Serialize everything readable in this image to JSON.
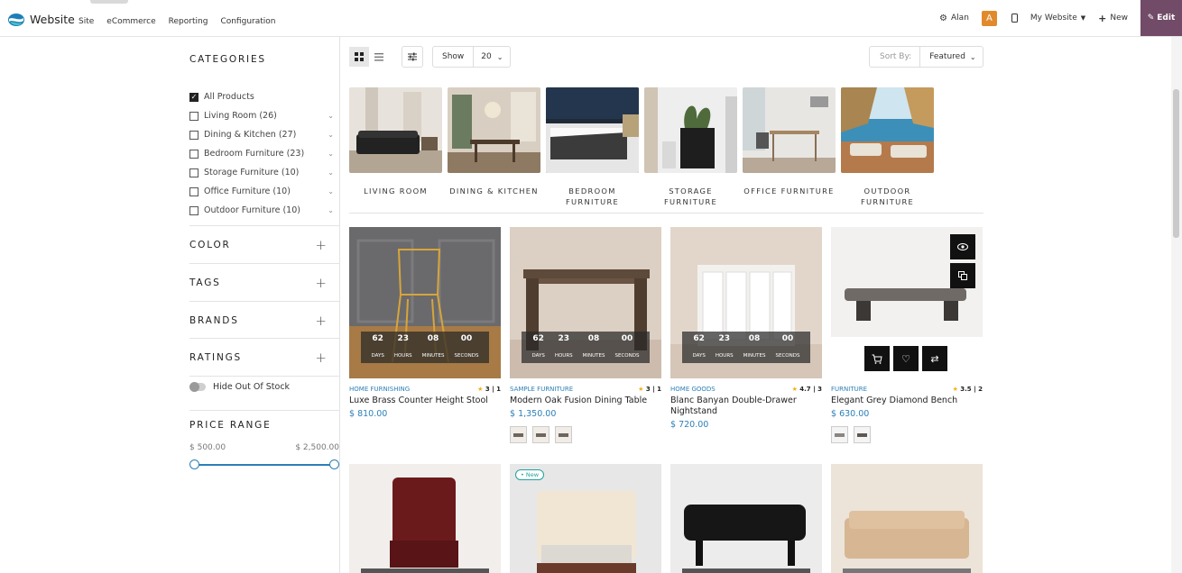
{
  "topbar": {
    "brand": "Website",
    "menu": [
      "Site",
      "eCommerce",
      "Reporting",
      "Configuration"
    ],
    "user": "Alan",
    "avatar_letter": "A",
    "website_select": "My Website",
    "new_label": "New",
    "edit_label": "Edit",
    "edit_color": "#714b67"
  },
  "sidebar": {
    "categories_title": "CATEGORIES",
    "categories": [
      {
        "label": "All Products",
        "checked": true
      },
      {
        "label": "Living Room (26)",
        "checked": false
      },
      {
        "label": "Dining & Kitchen (27)",
        "checked": false
      },
      {
        "label": "Bedroom Furniture (23)",
        "checked": false
      },
      {
        "label": "Storage Furniture (10)",
        "checked": false
      },
      {
        "label": "Office Furniture (10)",
        "checked": false
      },
      {
        "label": "Outdoor Furniture (10)",
        "checked": false
      }
    ],
    "facets": [
      "COLOR",
      "TAGS",
      "BRANDS",
      "RATINGS"
    ],
    "hide_stock": "Hide Out Of Stock",
    "price_title": "PRICE RANGE",
    "price_min": "$ 500.00",
    "price_max": "$ 2,500.00"
  },
  "toolbar": {
    "show_label": "Show",
    "show_value": "20",
    "sort_label": "Sort By:",
    "sort_value": "Featured"
  },
  "category_tiles": [
    {
      "label": "LIVING ROOM"
    },
    {
      "label": "DINING & KITCHEN"
    },
    {
      "label": "BEDROOM FURNITURE"
    },
    {
      "label": "STORAGE FURNITURE"
    },
    {
      "label": "OFFICE FURNITURE"
    },
    {
      "label": "OUTDOOR FURNITURE"
    }
  ],
  "countdown_labels": {
    "days": "DAYS",
    "hours": "HOURS",
    "minutes": "MINUTES",
    "seconds": "SECONDS"
  },
  "products": [
    {
      "category": "HOME FURNISHING",
      "rating": "3",
      "reviews": "1",
      "name": "Luxe Brass Counter Height Stool",
      "price": "$ 810.00",
      "countdown": [
        "62",
        "23",
        "08",
        "00"
      ]
    },
    {
      "category": "SAMPLE FURNITURE",
      "rating": "3",
      "reviews": "1",
      "name": "Modern Oak Fusion Dining Table",
      "price": "$ 1,350.00",
      "countdown": [
        "62",
        "23",
        "08",
        "00"
      ]
    },
    {
      "category": "HOME GOODS",
      "rating": "4.7",
      "reviews": "3",
      "name": "Blanc Banyan Double-Drawer Nightstand",
      "price": "$ 720.00",
      "countdown": [
        "62",
        "23",
        "08",
        "00"
      ]
    },
    {
      "category": "FURNITURE",
      "rating": "3.5",
      "reviews": "2",
      "name": "Elegant Grey Diamond Bench",
      "price": "$ 630.00"
    }
  ],
  "new_badge": "• New"
}
